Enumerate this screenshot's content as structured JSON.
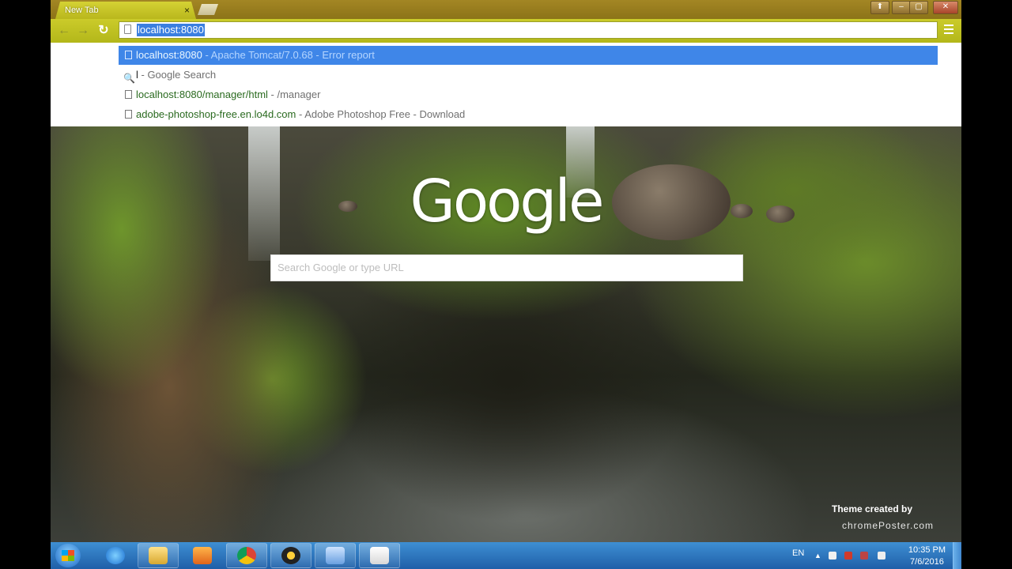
{
  "browser": {
    "tab_title": "New Tab",
    "tab_close": "×",
    "window_controls": [
      "⬆",
      "–",
      "▢",
      "✕"
    ],
    "omnibox_value": "localhost:8080"
  },
  "suggestions": [
    {
      "url": "localhost:8080",
      "desc": " - Apache Tomcat/7.0.68 - Error report",
      "icon": "page-icon"
    },
    {
      "url": "l",
      "desc": " - Google Search",
      "icon": "search-icon"
    },
    {
      "url": "localhost:8080/manager/html",
      "desc": " - /manager",
      "icon": "page-icon"
    },
    {
      "url": "adobe-photoshop-free.en.lo4d.com",
      "desc": " - Adobe Photoshop Free - Download",
      "icon": "page-icon"
    }
  ],
  "newtab": {
    "logo": "Google",
    "search_placeholder": "Search Google or type URL",
    "theme_line1": "Theme created by",
    "theme_line2": "chromePoster.com"
  },
  "taskbar": {
    "apps": [
      "ie-icon",
      "explorer-icon",
      "media-player-icon",
      "chrome-icon",
      "music-icon",
      "control-panel-icon",
      "java-icon"
    ],
    "language": "EN",
    "time": "10:35 PM",
    "date": "7/6/2016"
  },
  "colors": {
    "theme_bar": "#c4c42a",
    "selection": "#3f86e8",
    "taskbar": "#2e76c0"
  }
}
